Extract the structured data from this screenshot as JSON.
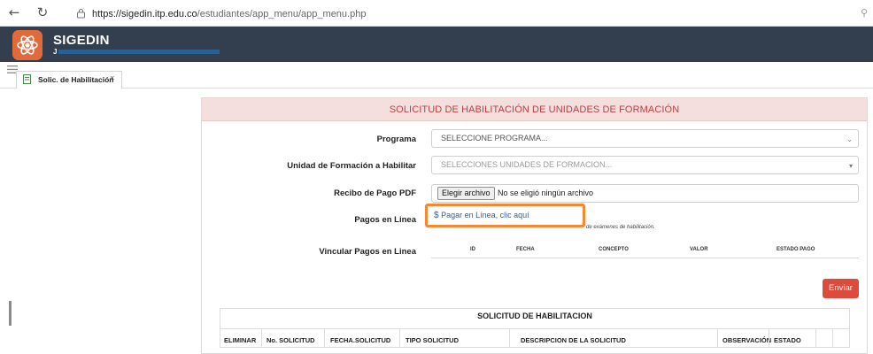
{
  "browser": {
    "url_host": "https://sigedin.itp.edu.co",
    "url_path": "/estudiantes/app_menu/app_menu.php"
  },
  "app": {
    "title": "SIGEDIN",
    "user_name": "J"
  },
  "tabs": [
    {
      "label": "Solic. de Habilitación",
      "close": "×"
    }
  ],
  "form": {
    "heading": "SOLICITUD DE HABILITACIÓN DE UNIDADES DE FORMACIÓN",
    "programa_label": "Programa",
    "programa_value": "SELECCIONE PROGRAMA...",
    "unidad_label": "Unidad de Formación a Habilitar",
    "unidad_placeholder": "SELECCIONES UNIDADES DE FORMACION...",
    "recibo_label": "Recibo de Pago PDF",
    "file_button": "Elegir archivo",
    "file_status": "No se eligió ningún archivo",
    "pagos_label": "Pagos en Linea",
    "pay_symbol": "$",
    "pay_link": "Pagar en Línea, clic aquí",
    "pay_note": "de exámenes de habilitación.",
    "vincular_label": "Vincular Pagos en Linea",
    "vincular_headers": [
      "ID",
      "FECHA",
      "CONCEPTO",
      "VALOR",
      "ESTADO PAGO"
    ],
    "send_button": "Enviar"
  },
  "table": {
    "title": "SOLICITUD DE HABILITACION",
    "headers": [
      "ELIMINAR",
      "No. SOLICITUD",
      "FECHA.SOLICITUD",
      "TIPO SOLICITUD",
      "DESCRIPCION DE LA SOLICITUD",
      "OBSERVACIÓN",
      "ESTADO"
    ]
  },
  "colors": {
    "header_bg": "#333f4f",
    "logo": "#e06a3a",
    "panel_head_bg": "#f5dede",
    "panel_head_text": "#b9413f",
    "highlight": "#f28a35",
    "send_button": "#dc4b3b",
    "link": "#2d5fa8"
  },
  "icons": [
    "back-arrow-icon",
    "reload-icon",
    "lock-icon",
    "menu-icon",
    "document-icon",
    "close-icon",
    "chevron-down-icon",
    "dollar-icon"
  ]
}
